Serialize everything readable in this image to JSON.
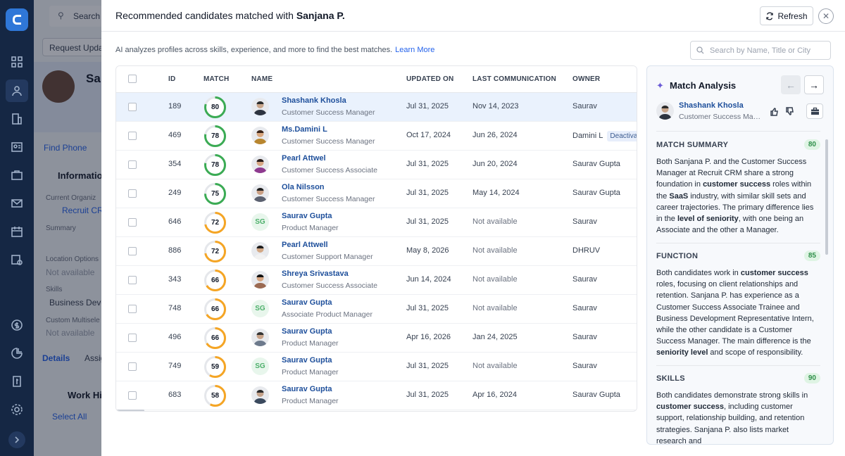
{
  "background": {
    "search_placeholder": "Search",
    "request_update": "Request Update",
    "person_name_partial": "Sa",
    "find_phone": "Find Phone",
    "information": "Information",
    "current_org_label": "Current Organiz",
    "current_org_value": "Recruit CRM",
    "summary_label": "Summary",
    "location_label": "Location Options",
    "location_value": "Not available",
    "skills_label": "Skills",
    "skills_value": "Business Devel",
    "custom_label": "Custom Multisele",
    "custom_value": "Not available",
    "tab_details": "Details",
    "tab_assign": "Assig",
    "work_history": "Work His",
    "select_all": "Select All"
  },
  "panel": {
    "title_prefix": "Recommended candidates matched with ",
    "title_name": "Sanjana P.",
    "refresh_label": "Refresh",
    "subtitle": "AI analyzes profiles across skills, experience, and more to find the best matches.",
    "learn_more": "Learn More",
    "search_placeholder": "Search by Name, Title or City"
  },
  "table": {
    "headers": {
      "id": "ID",
      "match": "MATCH",
      "name": "NAME",
      "updated": "UPDATED ON",
      "last_comm": "LAST COMMUNICATION",
      "owner": "OWNER"
    },
    "rows": [
      {
        "id": "189",
        "match": 80,
        "name": "Shashank Khosla",
        "title": "Customer Success Manager",
        "updated": "Jul 31, 2025",
        "last": "Nov 14, 2023",
        "owner": "Saurav",
        "avatar": "photo",
        "selected": true
      },
      {
        "id": "469",
        "match": 78,
        "name": "Ms.Damini L",
        "title": "Customer Success Manager",
        "updated": "Oct 17, 2024",
        "last": "Jun 26, 2024",
        "owner": "Damini L",
        "badge": "Deactivate",
        "avatar": "photo"
      },
      {
        "id": "354",
        "match": 78,
        "name": "Pearl Attwel",
        "title": "Customer Success Associate",
        "updated": "Jul 31, 2025",
        "last": "Jun 20, 2024",
        "owner": "Saurav Gupta",
        "avatar": "photo"
      },
      {
        "id": "249",
        "match": 75,
        "name": "Ola Nilsson",
        "title": "Customer Success Manager",
        "updated": "Jul 31, 2025",
        "last": "May 14, 2024",
        "owner": "Saurav Gupta",
        "avatar": "photo"
      },
      {
        "id": "646",
        "match": 72,
        "name": "Saurav Gupta",
        "title": "Product Manager",
        "updated": "Jul 31, 2025",
        "last": "Not available",
        "owner": "Saurav",
        "avatar": "SG"
      },
      {
        "id": "886",
        "match": 72,
        "name": "Pearl Attwell",
        "title": "Customer Support Manager",
        "updated": "May 8, 2026",
        "last": "Not available",
        "owner": "DHRUV",
        "avatar": "photo"
      },
      {
        "id": "343",
        "match": 66,
        "name": "Shreya Srivastava",
        "title": "Customer Success Associate",
        "updated": "Jun 14, 2024",
        "last": "Not available",
        "owner": "Saurav",
        "avatar": "photo"
      },
      {
        "id": "748",
        "match": 66,
        "name": "Saurav Gupta",
        "title": "Associate Product Manager",
        "updated": "Jul 31, 2025",
        "last": "Not available",
        "owner": "Saurav",
        "avatar": "SG"
      },
      {
        "id": "496",
        "match": 66,
        "name": "Saurav Gupta",
        "title": "Product Manager",
        "updated": "Apr 16, 2026",
        "last": "Jan 24, 2025",
        "owner": "Saurav",
        "avatar": "photo"
      },
      {
        "id": "749",
        "match": 59,
        "name": "Saurav Gupta",
        "title": "Product Manager",
        "updated": "Jul 31, 2025",
        "last": "Not available",
        "owner": "Saurav",
        "avatar": "SG"
      },
      {
        "id": "683",
        "match": 58,
        "name": "Saurav Gupta",
        "title": "Product Manager",
        "updated": "Jul 31, 2025",
        "last": "Apr 16, 2024",
        "owner": "Saurav Gupta",
        "avatar": "photo"
      }
    ]
  },
  "match_analysis": {
    "title": "Match Analysis",
    "candidate_name": "Shashank Khosla",
    "candidate_title": "Customer Success Manager",
    "summary": {
      "label": "MATCH SUMMARY",
      "score": "80"
    },
    "function": {
      "label": "FUNCTION",
      "score": "85"
    },
    "skills": {
      "label": "SKILLS",
      "score": "90"
    }
  },
  "colors": {
    "ring_green": "#3bab54",
    "ring_orange": "#f5a524",
    "ring_track": "#e5e7eb",
    "link": "#1e4f9b"
  }
}
